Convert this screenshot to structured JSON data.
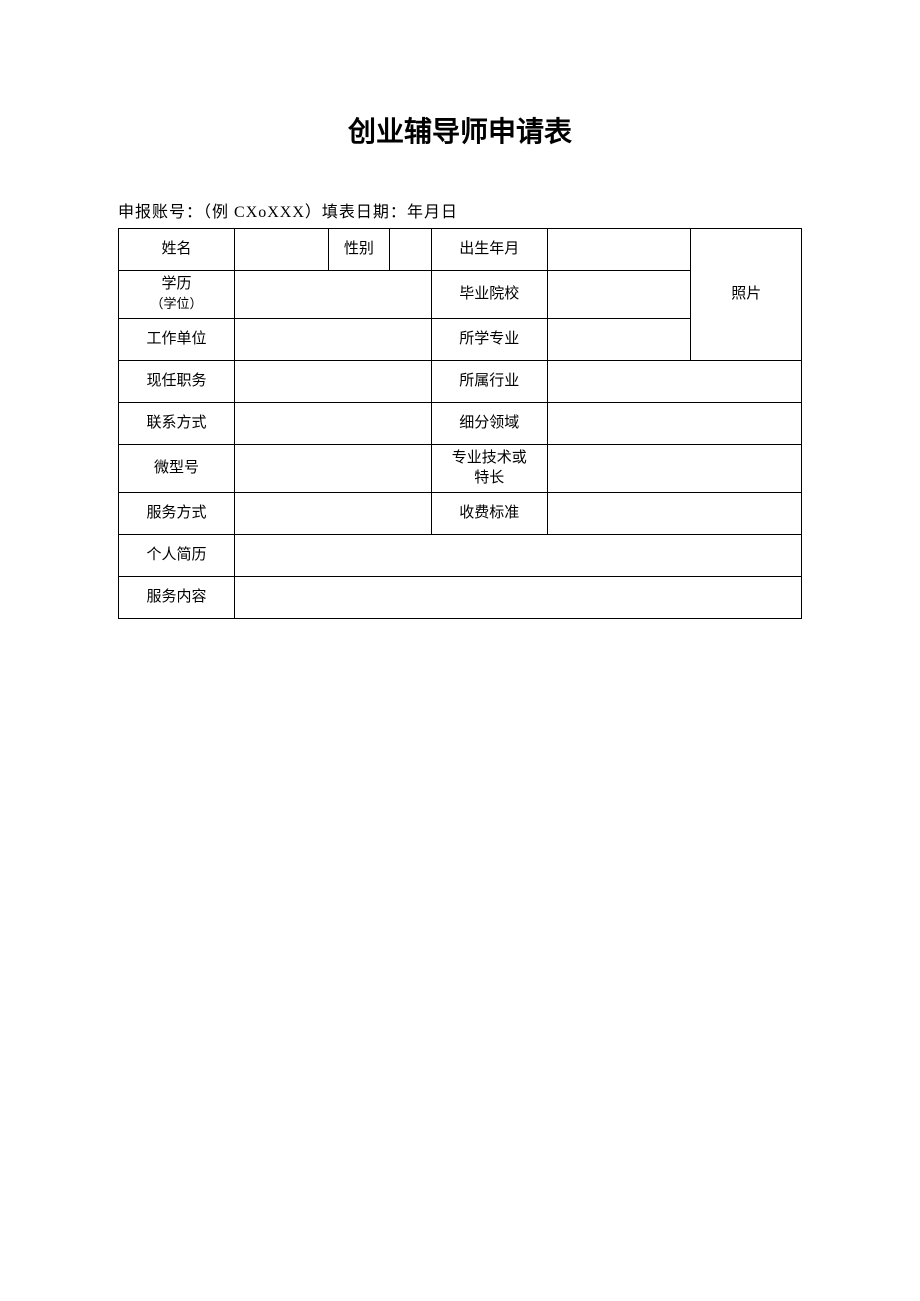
{
  "title": "创业辅导师申请表",
  "header": {
    "account_label": "申报账号：",
    "account_example": "（例 CXoXXX）",
    "date_label": "填表日期：",
    "date_value": "年月日"
  },
  "labels": {
    "name": "姓名",
    "gender": "性别",
    "birth": "出生年月",
    "education": "学历",
    "education_sub": "（学位）",
    "school": "毕业院校",
    "photo": "照片",
    "workplace": "工作单位",
    "major": "所学专业",
    "position": "现任职务",
    "industry": "所属行业",
    "contact": "联系方式",
    "subfield": "细分领域",
    "wechat": "微型号",
    "specialty_line1": "专业技术或",
    "specialty_line2": "特长",
    "service_mode": "服务方式",
    "fee": "收费标准",
    "resume": "个人简历",
    "service_content": "服务内容"
  },
  "values": {
    "name": "",
    "gender": "",
    "birth": "",
    "education": "",
    "school": "",
    "workplace": "",
    "major": "",
    "position": "",
    "industry": "",
    "contact": "",
    "subfield": "",
    "wechat": "",
    "specialty": "",
    "service_mode": "",
    "fee": "",
    "resume": "",
    "service_content": ""
  }
}
